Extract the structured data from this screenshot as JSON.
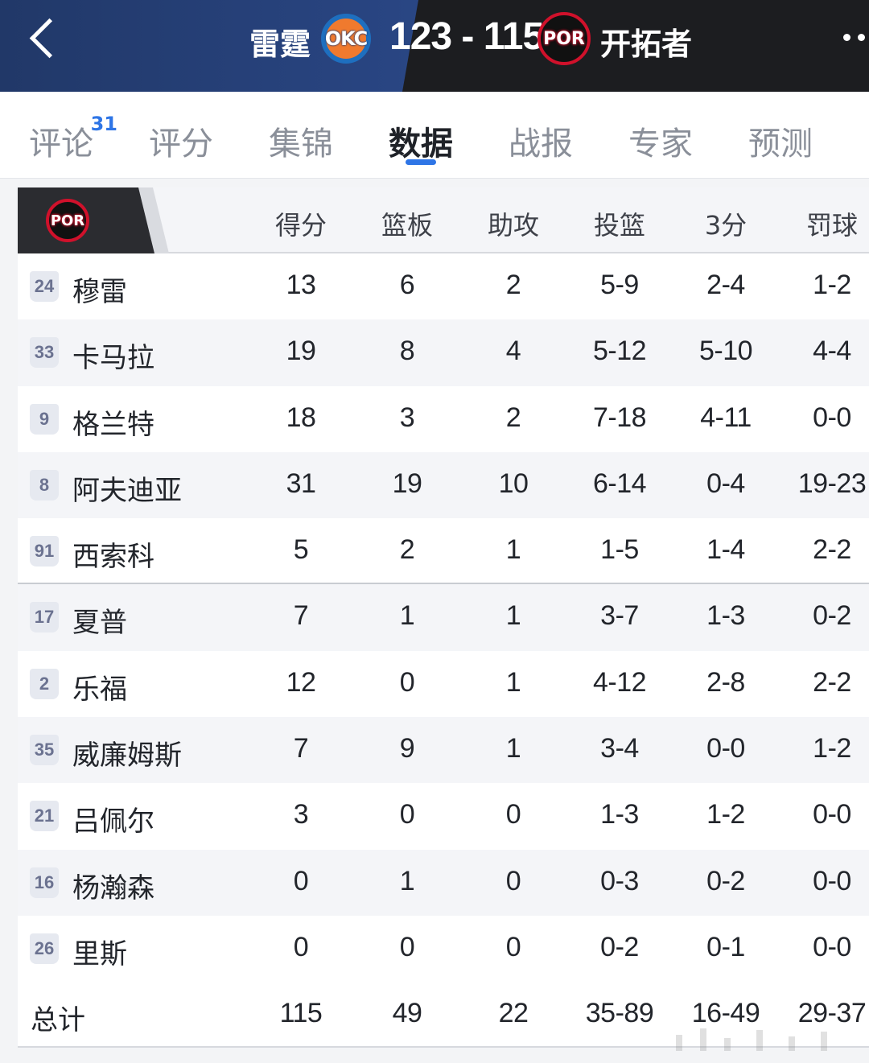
{
  "header": {
    "home_team": "雷霆",
    "home_logo": "OKC",
    "score": "123 - 115",
    "away_logo": "POR",
    "away_team": "开拓者"
  },
  "tabs": [
    {
      "label": "评论",
      "badge": "31"
    },
    {
      "label": "评分"
    },
    {
      "label": "集锦"
    },
    {
      "label": "数据"
    },
    {
      "label": "战报"
    },
    {
      "label": "专家"
    },
    {
      "label": "预测"
    }
  ],
  "table": {
    "team_logo": "POR",
    "columns": [
      "得分",
      "篮板",
      "助攻",
      "投篮",
      "3分",
      "罚球"
    ],
    "players": [
      {
        "number": "24",
        "name": "穆雷",
        "pts": "13",
        "reb": "6",
        "ast": "2",
        "fg": "5-9",
        "three": "2-4",
        "ft": "1-2"
      },
      {
        "number": "33",
        "name": "卡马拉",
        "pts": "19",
        "reb": "8",
        "ast": "4",
        "fg": "5-12",
        "three": "5-10",
        "ft": "4-4"
      },
      {
        "number": "9",
        "name": "格兰特",
        "pts": "18",
        "reb": "3",
        "ast": "2",
        "fg": "7-18",
        "three": "4-11",
        "ft": "0-0"
      },
      {
        "number": "8",
        "name": "阿夫迪亚",
        "pts": "31",
        "reb": "19",
        "ast": "10",
        "fg": "6-14",
        "three": "0-4",
        "ft": "19-23"
      },
      {
        "number": "91",
        "name": "西索科",
        "pts": "5",
        "reb": "2",
        "ast": "1",
        "fg": "1-5",
        "three": "1-4",
        "ft": "2-2"
      },
      {
        "number": "17",
        "name": "夏普",
        "pts": "7",
        "reb": "1",
        "ast": "1",
        "fg": "3-7",
        "three": "1-3",
        "ft": "0-2"
      },
      {
        "number": "2",
        "name": "乐福",
        "pts": "12",
        "reb": "0",
        "ast": "1",
        "fg": "4-12",
        "three": "2-8",
        "ft": "2-2"
      },
      {
        "number": "35",
        "name": "威廉姆斯",
        "pts": "7",
        "reb": "9",
        "ast": "1",
        "fg": "3-4",
        "three": "0-0",
        "ft": "1-2"
      },
      {
        "number": "21",
        "name": "吕佩尔",
        "pts": "3",
        "reb": "0",
        "ast": "0",
        "fg": "1-3",
        "three": "1-2",
        "ft": "0-0"
      },
      {
        "number": "16",
        "name": "杨瀚森",
        "pts": "0",
        "reb": "1",
        "ast": "0",
        "fg": "0-3",
        "three": "0-2",
        "ft": "0-0"
      },
      {
        "number": "26",
        "name": "里斯",
        "pts": "0",
        "reb": "0",
        "ast": "0",
        "fg": "0-2",
        "three": "0-1",
        "ft": "0-0"
      }
    ],
    "totals": {
      "label": "总计",
      "pts": "115",
      "reb": "49",
      "ast": "22",
      "fg": "35-89",
      "three": "16-49",
      "ft": "29-37"
    }
  }
}
